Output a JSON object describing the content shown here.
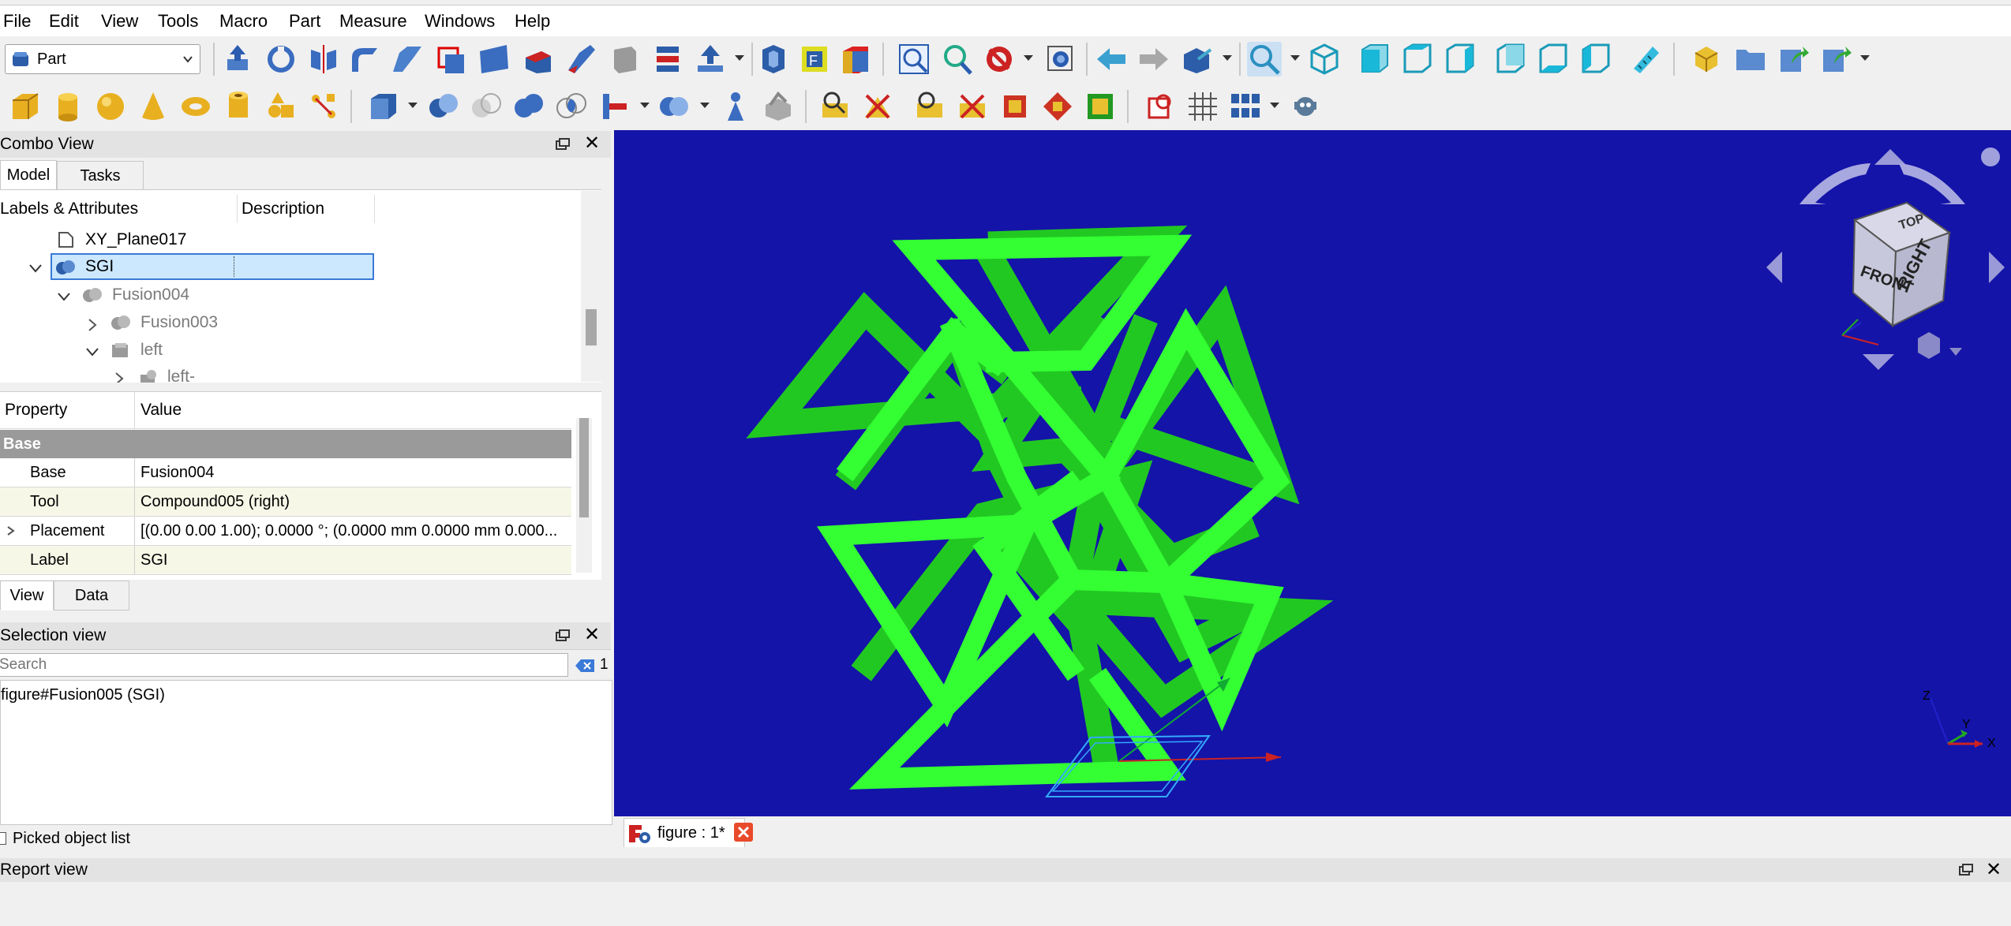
{
  "menu": [
    "File",
    "Edit",
    "View",
    "Tools",
    "Macro",
    "Part",
    "Measure",
    "Windows",
    "Help"
  ],
  "workbench": {
    "selected": "Part"
  },
  "combo_view": {
    "title": "Combo View",
    "tabs": [
      "Model",
      "Tasks"
    ],
    "tree_headers": [
      "Labels & Attributes",
      "Description"
    ],
    "tree_items": [
      {
        "label": "XY_Plane017",
        "level": 2
      },
      {
        "label": "SGI",
        "level": 1,
        "selected": true
      },
      {
        "label": "Fusion004",
        "level": 2
      },
      {
        "label": "Fusion003",
        "level": 3
      },
      {
        "label": "left",
        "level": 3
      },
      {
        "label": "left-t",
        "level": 4
      }
    ]
  },
  "property_editor": {
    "headers": [
      "Property",
      "Value"
    ],
    "group": "Base",
    "rows": [
      {
        "name": "Base",
        "value": "Fusion004"
      },
      {
        "name": "Tool",
        "value": "Compound005 (right)"
      },
      {
        "name": "Placement",
        "value": "[(0.00 0.00 1.00); 0.0000 °; (0.0000 mm  0.0000 mm  0.000..."
      },
      {
        "name": "Label",
        "value": "SGI"
      }
    ],
    "tabs": [
      "View",
      "Data"
    ]
  },
  "selection_view": {
    "title": "Selection view",
    "search_placeholder": "Search",
    "count": "1",
    "items": [
      "figure#Fusion005 (SGI)"
    ],
    "picked_label": "Picked object list"
  },
  "document_tab": {
    "label": "figure : 1*"
  },
  "report_view": {
    "title": "Report view"
  },
  "navcube": {
    "front": "FRONT",
    "right": "RIGHT",
    "top": "TOP"
  },
  "axes_labels": {
    "z": "Z",
    "y": "Y",
    "x": "X"
  },
  "colors": {
    "viewport_bg": "#1414a8",
    "model": "#33ff33",
    "selection": "#cce8ff"
  }
}
